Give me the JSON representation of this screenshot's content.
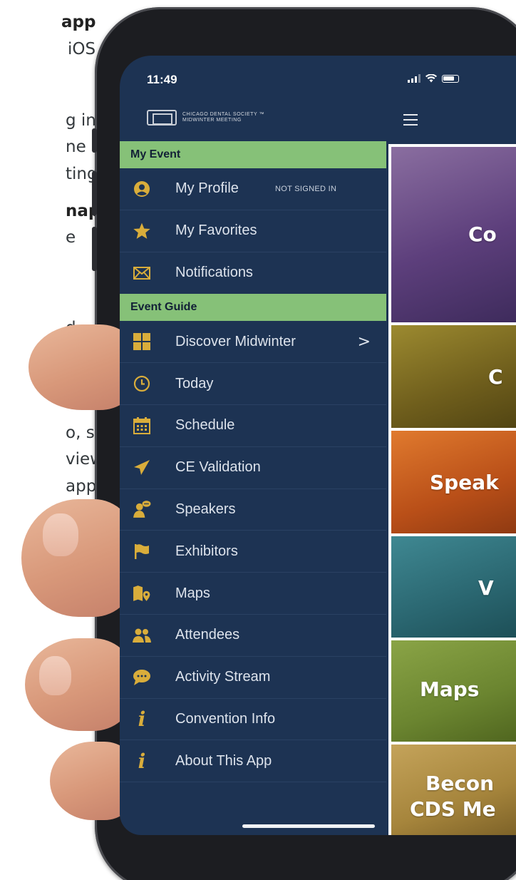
{
  "background_text": {
    "lines": [
      "app",
      "iOS",
      "g in",
      "ne",
      "ting.",
      "nap",
      "e",
      "d",
      "o, stay",
      "view",
      "app."
    ]
  },
  "status_bar": {
    "time": "11:49"
  },
  "header": {
    "logo_line1": "CHICAGO DENTAL SOCIETY ™",
    "logo_line2": "MIDWINTER MEETING",
    "menu_icon": "hamburger-icon"
  },
  "drawer": {
    "sections": [
      {
        "title": "My Event",
        "items": [
          {
            "label": "My Profile",
            "icon": "profile-icon",
            "badge": "NOT SIGNED IN"
          },
          {
            "label": "My Favorites",
            "icon": "star-icon"
          },
          {
            "label": "Notifications",
            "icon": "envelope-icon"
          }
        ]
      },
      {
        "title": "Event Guide",
        "items": [
          {
            "label": "Discover Midwinter",
            "icon": "grid-icon",
            "chevron": ">"
          },
          {
            "label": "Today",
            "icon": "clock-icon"
          },
          {
            "label": "Schedule",
            "icon": "calendar-icon"
          },
          {
            "label": "CE Validation",
            "icon": "paper-plane-icon"
          },
          {
            "label": "Speakers",
            "icon": "speaker-icon"
          },
          {
            "label": "Exhibitors",
            "icon": "flag-icon"
          },
          {
            "label": "Maps",
            "icon": "map-icon"
          },
          {
            "label": "Attendees",
            "icon": "attendees-icon"
          },
          {
            "label": "Activity Stream",
            "icon": "chat-bubble-icon"
          },
          {
            "label": "Convention Info",
            "icon": "info-icon"
          },
          {
            "label": "About This App",
            "icon": "info-icon"
          }
        ]
      }
    ]
  },
  "tiles": [
    {
      "label": "Co",
      "color": "#6e4a86"
    },
    {
      "label": "C",
      "color": "#7a6a22"
    },
    {
      "label": "Speak",
      "color": "#c85a1c"
    },
    {
      "label": "V",
      "color": "#2e6e78"
    },
    {
      "label": "Maps",
      "color": "#6f8a36"
    },
    {
      "label_line1": "Becon",
      "label_line2": "CDS Me",
      "color": "#a6853c"
    }
  ],
  "colors": {
    "drawer_bg": "#1d3353",
    "section_header": "#86c178",
    "icon_gold": "#d9ad3b",
    "phone_frame": "#1c1d21"
  }
}
